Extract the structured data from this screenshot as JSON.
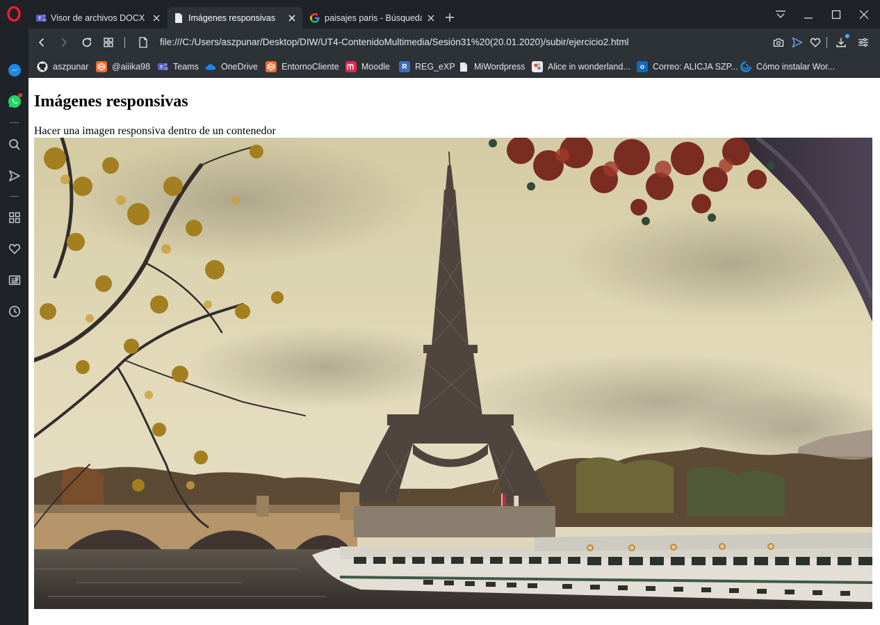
{
  "browser": {
    "tabs": [
      {
        "title": "Visor de archivos DOCX | M",
        "favicon": "teams-icon",
        "active": false
      },
      {
        "title": "Imágenes responsivas",
        "favicon": "document-icon",
        "active": true
      },
      {
        "title": "paisajes paris - Búsqueda d",
        "favicon": "google-icon",
        "active": false
      }
    ],
    "url": "file:///C:/Users/aszpunar/Desktop/DIW/UT4-ContenidoMultimedia/Sesión31%20(20.01.2020)/subir/ejercicio2.html",
    "bookmarks": [
      {
        "label": "aszpunar",
        "icon": "github-icon"
      },
      {
        "label": "@aiiika98",
        "icon": "codepen-icon"
      },
      {
        "label": "Teams",
        "icon": "teams-icon"
      },
      {
        "label": "OneDrive",
        "icon": "onedrive-icon"
      },
      {
        "label": "EntornoCliente",
        "icon": "codepen-icon"
      },
      {
        "label": "Moodle",
        "icon": "moodle-icon"
      },
      {
        "label": "REG_eXP",
        "icon": "r-icon"
      },
      {
        "label": "MiWordpress",
        "icon": "document-icon"
      },
      {
        "label": "Alice in wonderland...",
        "icon": "alice-icon"
      },
      {
        "label": "Correo: ALICJA SZP...",
        "icon": "outlook-icon"
      },
      {
        "label": "Cómo instalar Wor...",
        "icon": "loader-icon"
      }
    ],
    "sidebar": [
      "messenger-icon",
      "whatsapp-icon",
      "search-icon",
      "send-icon",
      "speed-dial-icon",
      "heart-icon",
      "news-icon",
      "history-icon"
    ],
    "colors": {
      "frame": "#1f2327",
      "toolbar": "#2d3237",
      "opera_red": "#ff1b2d",
      "messenger": "#1e88e5",
      "whatsapp": "#25d366"
    }
  },
  "page": {
    "heading": "Imágenes responsivas",
    "description": "Hacer una imagen responsiva dentro de un contenedor",
    "image_subject": "eiffel-tower-photo"
  }
}
